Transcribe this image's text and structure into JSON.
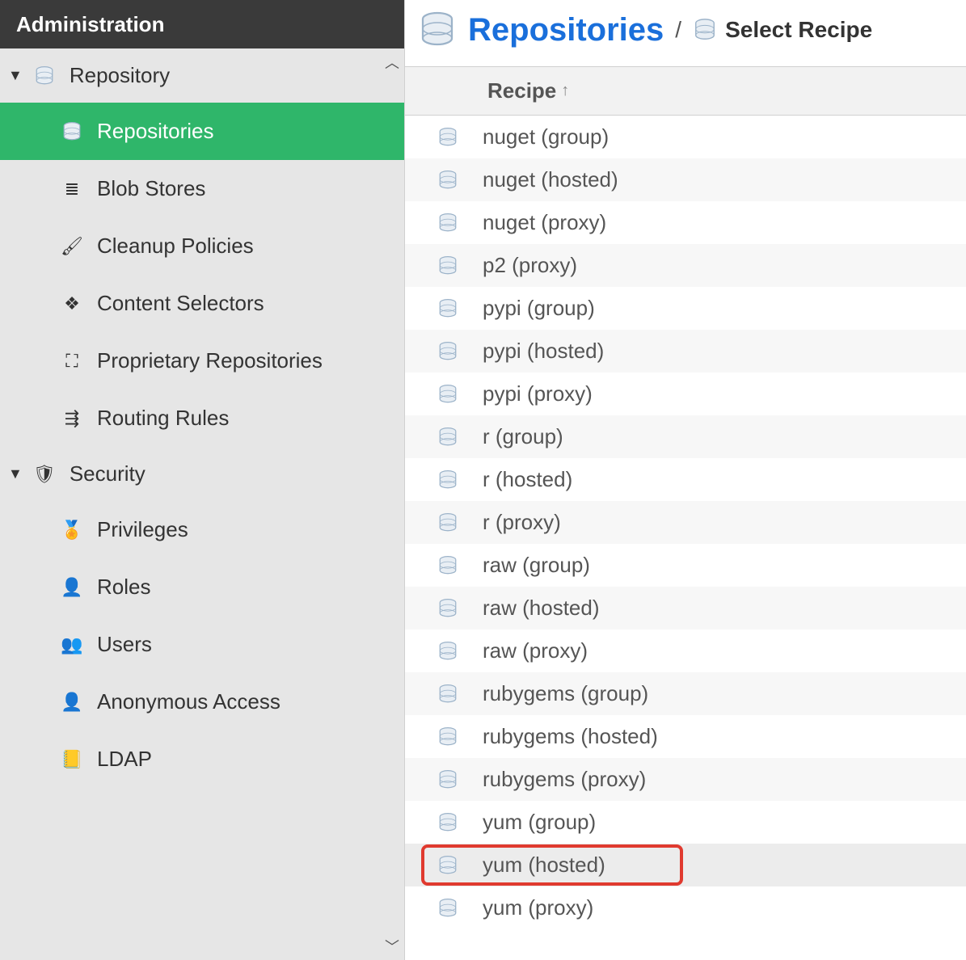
{
  "sidebar": {
    "header": "Administration",
    "sections": [
      {
        "label": "Repository",
        "items": [
          {
            "id": "repositories",
            "label": "Repositories",
            "icon": "database-icon",
            "active": true
          },
          {
            "id": "blob-stores",
            "label": "Blob Stores",
            "icon": "storage-icon"
          },
          {
            "id": "cleanup-policies",
            "label": "Cleanup Policies",
            "icon": "broom-icon"
          },
          {
            "id": "content-selectors",
            "label": "Content Selectors",
            "icon": "layers-icon"
          },
          {
            "id": "proprietary-repositories",
            "label": "Proprietary Repositories",
            "icon": "box-icon"
          },
          {
            "id": "routing-rules",
            "label": "Routing Rules",
            "icon": "signpost-icon"
          }
        ]
      },
      {
        "label": "Security",
        "items": [
          {
            "id": "privileges",
            "label": "Privileges",
            "icon": "medal-icon"
          },
          {
            "id": "roles",
            "label": "Roles",
            "icon": "person-icon"
          },
          {
            "id": "users",
            "label": "Users",
            "icon": "users-icon"
          },
          {
            "id": "anonymous-access",
            "label": "Anonymous Access",
            "icon": "user-icon"
          },
          {
            "id": "ldap",
            "label": "LDAP",
            "icon": "book-icon"
          }
        ]
      }
    ]
  },
  "breadcrumb": {
    "title": "Repositories",
    "current": "Select Recipe"
  },
  "table": {
    "column_header": "Recipe",
    "sort_direction": "asc",
    "rows": [
      {
        "name": "nuget (group)"
      },
      {
        "name": "nuget (hosted)"
      },
      {
        "name": "nuget (proxy)"
      },
      {
        "name": "p2 (proxy)"
      },
      {
        "name": "pypi (group)"
      },
      {
        "name": "pypi (hosted)"
      },
      {
        "name": "pypi (proxy)"
      },
      {
        "name": "r (group)"
      },
      {
        "name": "r (hosted)"
      },
      {
        "name": "r (proxy)"
      },
      {
        "name": "raw (group)"
      },
      {
        "name": "raw (hosted)"
      },
      {
        "name": "raw (proxy)"
      },
      {
        "name": "rubygems (group)"
      },
      {
        "name": "rubygems (hosted)"
      },
      {
        "name": "rubygems (proxy)"
      },
      {
        "name": "yum (group)"
      },
      {
        "name": "yum (hosted)",
        "highlighted": true
      },
      {
        "name": "yum (proxy)"
      }
    ]
  },
  "icons": {
    "database-icon": "db-svg",
    "storage-icon": "≣",
    "broom-icon": "🖌",
    "layers-icon": "❖",
    "box-icon": "⛶",
    "signpost-icon": "⇶",
    "shield-icon": "🛡",
    "medal-icon": "🏅",
    "person-icon": "👤",
    "users-icon": "👥",
    "user-icon": "👤",
    "book-icon": "📒"
  }
}
